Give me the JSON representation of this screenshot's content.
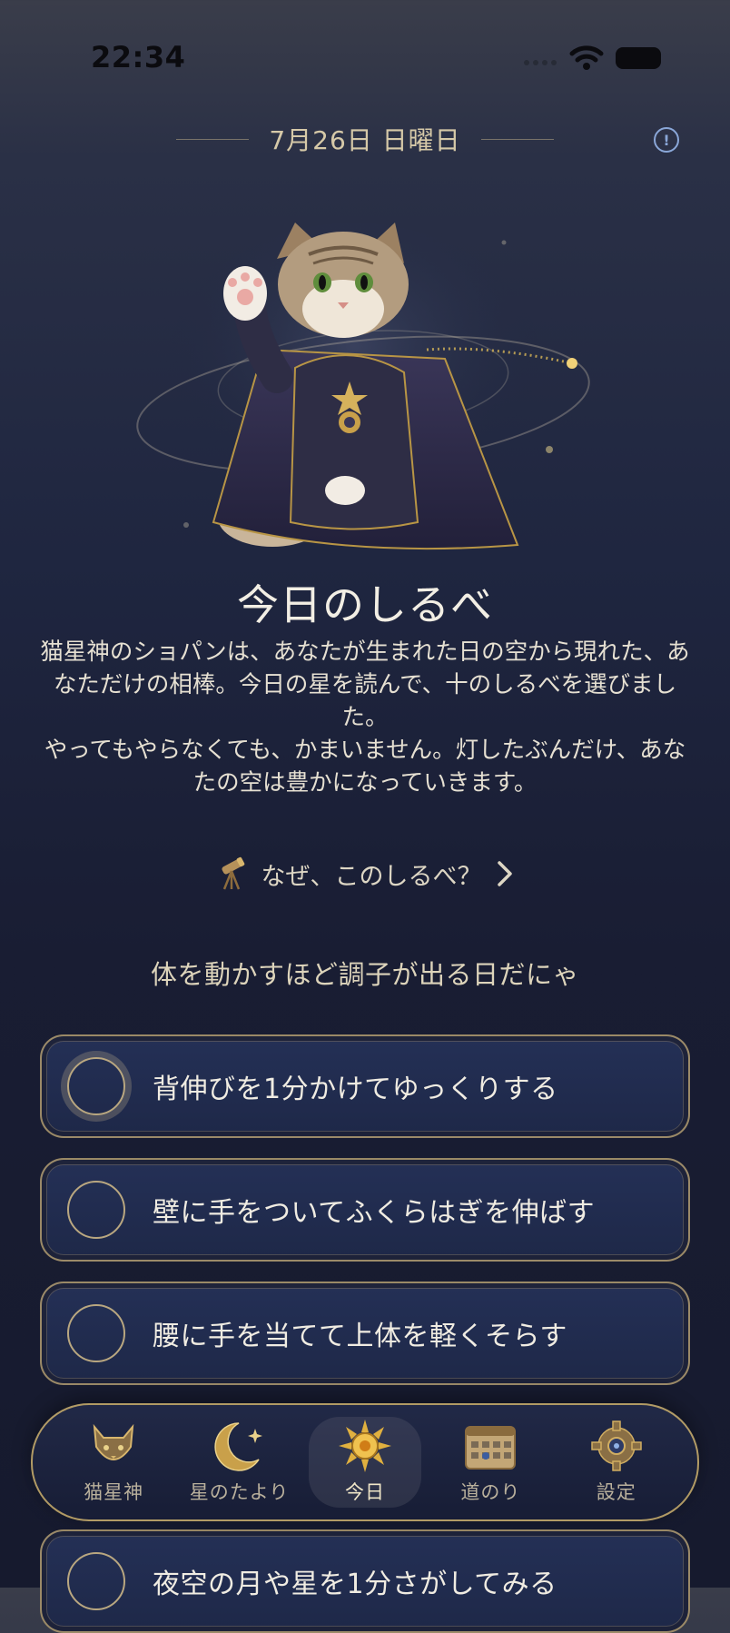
{
  "status_bar": {
    "time": "22:34"
  },
  "header": {
    "date": "7月26日 日曜日",
    "info_icon": "info-circle-icon"
  },
  "hero": {
    "image": "cat-star-god-chopin-illustration"
  },
  "main": {
    "title": "今日のしるべ",
    "intro_paragraph_1": "猫星神のショパンは、あなたが生まれた日の空から現れた、あなただけの相棒。今日の星を読んで、十のしるべを選びました。",
    "intro_paragraph_2": "やってもやらなくても、かまいません。灯したぶんだけ、あなたの空は豊かになっていきます。",
    "why_link": "なぜ、このしるべ？",
    "whisper": "体を動かすほど調子が出る日だにゃ"
  },
  "tasks": [
    {
      "label": "背伸びを1分かけてゆっくりする",
      "done": false
    },
    {
      "label": "壁に手をついてふくらはぎを伸ばす",
      "done": false
    },
    {
      "label": "腰に手を当てて上体を軽くそらす",
      "done": false
    },
    {
      "label": "夜空の月や星を1分さがしてみる",
      "done": false
    }
  ],
  "tabbar": {
    "tabs": [
      {
        "label": "猫星神",
        "icon": "cat-emblem-icon"
      },
      {
        "label": "星のたより",
        "icon": "crescent-moon-icon"
      },
      {
        "label": "今日",
        "icon": "sun-icon"
      },
      {
        "label": "道のり",
        "icon": "calendar-icon"
      },
      {
        "label": "設定",
        "icon": "gear-icon"
      }
    ],
    "active": "今日"
  },
  "colors": {
    "accent_gold": "#c9a86a",
    "bg_navy": "#1f2640",
    "card_navy": "#243056"
  }
}
